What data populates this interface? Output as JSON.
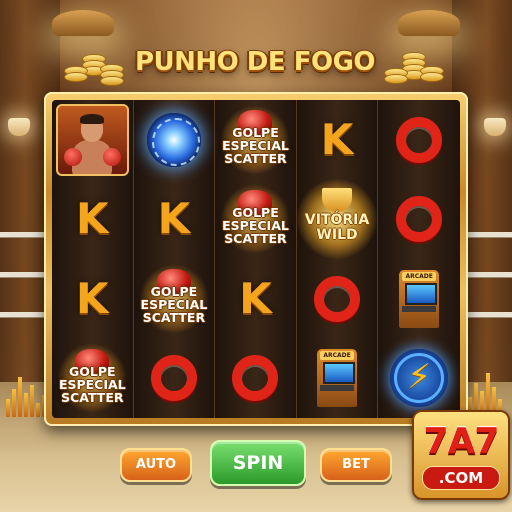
{
  "game": {
    "title": "PUNHO DE FOGO",
    "reels": [
      [
        {
          "type": "image",
          "icon": "boxer-portrait-icon"
        },
        {
          "type": "letter",
          "text": "K"
        },
        {
          "type": "letter",
          "text": "K"
        },
        {
          "type": "scatter",
          "text": "GOLPE ESPECIAL SCATTER",
          "icon": "boxing-glove-icon"
        }
      ],
      [
        {
          "type": "image",
          "icon": "blue-energy-orb-icon"
        },
        {
          "type": "letter",
          "text": "K"
        },
        {
          "type": "scatter",
          "text": "GOLPE ESPECIAL SCATTER",
          "icon": "boxing-glove-icon"
        },
        {
          "type": "o",
          "icon": "red-o-icon"
        }
      ],
      [
        {
          "type": "scatter",
          "text": "GOLPE ESPECIAL SCATTER",
          "icon": "boxing-glove-icon"
        },
        {
          "type": "scatter",
          "text": "GOLPE ESPECIAL SCATTER",
          "icon": "boxing-glove-icon"
        },
        {
          "type": "letter",
          "text": "K"
        },
        {
          "type": "o",
          "icon": "red-o-icon"
        }
      ],
      [
        {
          "type": "letter",
          "text": "K"
        },
        {
          "type": "wild",
          "text": "VITÓRIA WILD",
          "icon": "trophy-icon"
        },
        {
          "type": "o",
          "icon": "red-o-icon"
        },
        {
          "type": "arcade",
          "text": "ARCADE",
          "icon": "arcade-machine-icon"
        }
      ],
      [
        {
          "type": "o",
          "icon": "red-o-icon"
        },
        {
          "type": "o",
          "icon": "red-o-icon"
        },
        {
          "type": "arcade",
          "text": "ARCADE",
          "icon": "arcade-machine-icon"
        },
        {
          "type": "bolt",
          "icon": "lightning-bolt-icon"
        }
      ]
    ]
  },
  "controls": {
    "auto_label": "AUTO",
    "spin_label": "SPIN",
    "bet_label": "BET"
  },
  "brand": {
    "logo_number": "7A7",
    "logo_domain": ".COM"
  },
  "colors": {
    "accent_gold": "#f5a51c",
    "spin_green": "#2a9a2a",
    "button_orange": "#d8621a",
    "symbol_red": "#e02418"
  }
}
